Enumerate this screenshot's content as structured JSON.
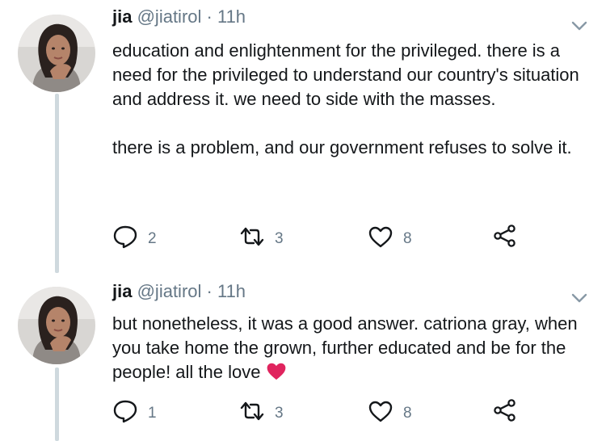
{
  "tweets": [
    {
      "name": "jia",
      "handle": "@jiatirol",
      "separator": "·",
      "time": "11h",
      "paragraphs": [
        "education and enlightenment for the privileged. there is a need for the privileged to understand our country's situation and address it. we need to side with the masses.",
        "there is a problem, and our government refuses to solve it."
      ],
      "actions": {
        "replies": "2",
        "retweets": "3",
        "likes": "8"
      }
    },
    {
      "name": "jia",
      "handle": "@jiatirol",
      "separator": "·",
      "time": "11h",
      "paragraphs": [
        "but nonetheless, it was a good answer. catriona gray, when you take home the grown, further educated and be for the people! all the love"
      ],
      "emoji": "red-heart-emoji",
      "actions": {
        "replies": "1",
        "retweets": "3",
        "likes": "8"
      }
    }
  ],
  "colors": {
    "text": "#14171a",
    "secondary": "#657786",
    "thread_line": "#cfd9de",
    "heart_emoji": "#e0245e"
  },
  "icons": [
    "reply-icon",
    "retweet-icon",
    "like-icon",
    "share-icon",
    "chevron-down-icon"
  ]
}
